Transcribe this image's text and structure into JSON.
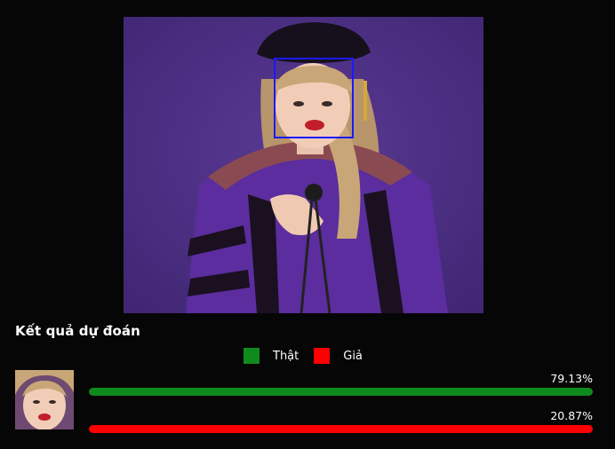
{
  "result": {
    "title": "Kết quả dự đoán"
  },
  "legend": [
    {
      "label": "Thật",
      "color": "#0f8a1c"
    },
    {
      "label": "Giả",
      "color": "#ff0000"
    }
  ],
  "predictions": [
    {
      "label": "Thật",
      "value_text": "79.13%",
      "fraction": 0.7913,
      "color": "#0f8a1c"
    },
    {
      "label": "Giả",
      "value_text": "20.87%",
      "fraction": 0.2087,
      "color": "#ff0000"
    }
  ],
  "colors": {
    "background": "#060606",
    "face_box": "#1a1aff"
  }
}
